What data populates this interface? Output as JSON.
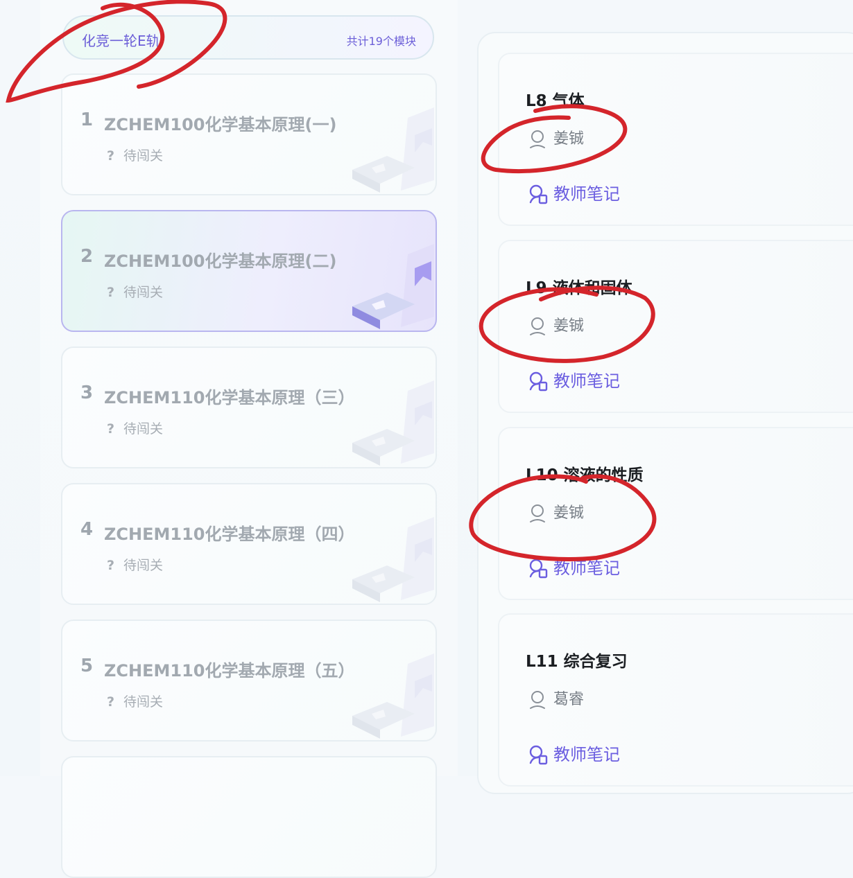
{
  "course": {
    "title": "化竞一轮E轨",
    "module_count": "共计19个模块"
  },
  "modules": [
    {
      "num": "1",
      "name": "ZCHEM100化学基本原理(一)",
      "status": "待闯关",
      "active": false
    },
    {
      "num": "2",
      "name": "ZCHEM100化学基本原理(二)",
      "status": "待闯关",
      "active": true
    },
    {
      "num": "3",
      "name": "ZCHEM110化学基本原理（三）",
      "status": "待闯关",
      "active": false
    },
    {
      "num": "4",
      "name": "ZCHEM110化学基本原理（四）",
      "status": "待闯关",
      "active": false
    },
    {
      "num": "5",
      "name": "ZCHEM110化学基本原理（五）",
      "status": "待闯关",
      "active": false
    }
  ],
  "module_status_icon": "question-icon",
  "lessons": [
    {
      "title": "L8 气体",
      "teacher": "姜铖",
      "notes_label": "教师笔记"
    },
    {
      "title": "L9 液体和固体",
      "teacher": "姜铖",
      "notes_label": "教师笔记"
    },
    {
      "title": "L10 溶液的性质",
      "teacher": "姜铖",
      "notes_label": "教师笔记"
    },
    {
      "title": "L11 综合复习",
      "teacher": "葛睿",
      "notes_label": "教师笔记"
    }
  ],
  "colors": {
    "accent": "#6b5ee0",
    "annotation": "#d4252b",
    "muted_text": "#a2a9b0"
  }
}
